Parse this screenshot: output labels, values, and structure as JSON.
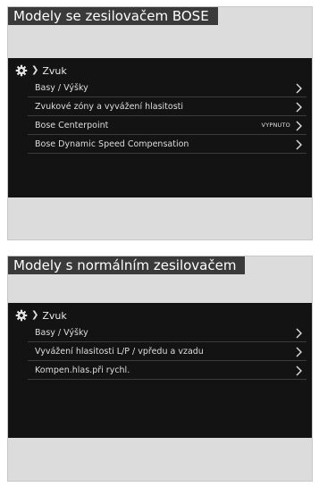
{
  "bose_panel": {
    "title": "Modely se zesilovačem BOSE",
    "breadcrumb": "Zvuk",
    "items": [
      {
        "label": "Basy / Výšky",
        "value": ""
      },
      {
        "label": "Zvukové zóny a vyvážení hlasitosti",
        "value": ""
      },
      {
        "label": "Bose Centerpoint",
        "value": "VYPNUTO"
      },
      {
        "label": "Bose Dynamic Speed Compensation",
        "value": ""
      }
    ]
  },
  "normal_panel": {
    "title": "Modely s normálním zesilovačem",
    "breadcrumb": "Zvuk",
    "items": [
      {
        "label": "Basy / Výšky"
      },
      {
        "label": "Vyvážení hlasitosti L/P / vpředu a vzadu"
      },
      {
        "label": "Kompen.hlas.při rychl."
      }
    ]
  },
  "icons": {
    "settings": "gear-icon",
    "separator": "chevron-right-icon",
    "row_arrow": "chevron-right-icon"
  },
  "colors": {
    "screen_bg": "#131313",
    "panel_bg": "#dcdcdc",
    "title_bg": "#3a3a3a",
    "text": "#dedede"
  }
}
